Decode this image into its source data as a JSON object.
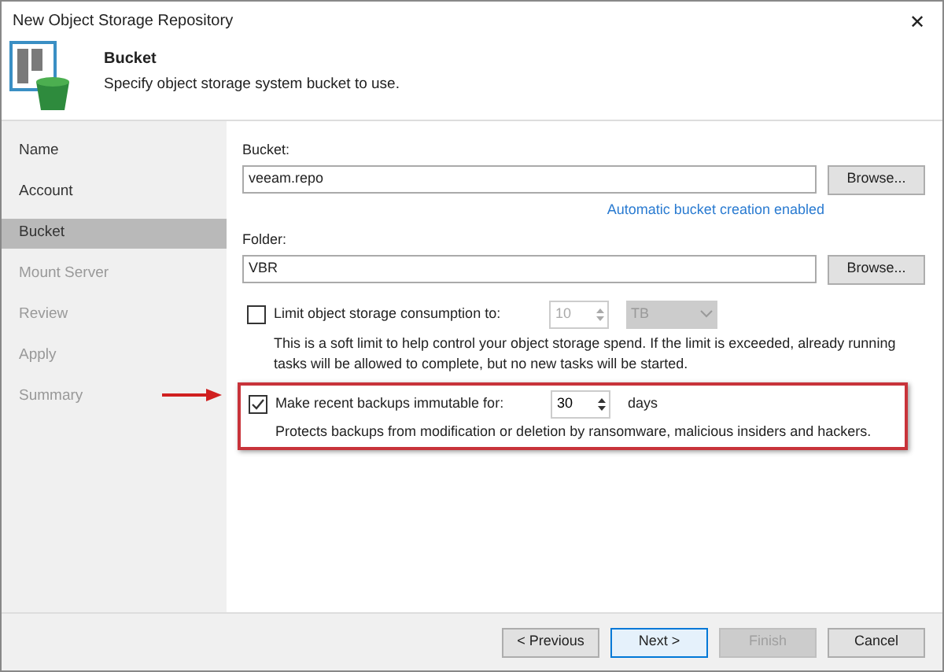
{
  "window": {
    "title": "New Object Storage Repository",
    "close": "✕"
  },
  "header": {
    "title": "Bucket",
    "subtitle": "Specify object storage system bucket to use."
  },
  "sidebar": {
    "items": [
      {
        "label": "Name",
        "selected": false,
        "disabled": false
      },
      {
        "label": "Account",
        "selected": false,
        "disabled": false
      },
      {
        "label": "Bucket",
        "selected": true,
        "disabled": false
      },
      {
        "label": "Mount Server",
        "selected": false,
        "disabled": true
      },
      {
        "label": "Review",
        "selected": false,
        "disabled": true
      },
      {
        "label": "Apply",
        "selected": false,
        "disabled": true
      },
      {
        "label": "Summary",
        "selected": false,
        "disabled": true
      }
    ]
  },
  "bucket": {
    "label": "Bucket:",
    "value": "veeam.repo",
    "browse": "Browse...",
    "link": "Automatic bucket creation enabled"
  },
  "folder": {
    "label": "Folder:",
    "value": "VBR",
    "browse": "Browse..."
  },
  "limit": {
    "label": "Limit object storage consumption to:",
    "checked": false,
    "value": "10",
    "unit": "TB",
    "disabled": true,
    "help": "This is a soft limit to help control your object storage spend. If the limit is exceeded, already running tasks will be allowed to complete, but no new tasks will be started."
  },
  "immutable": {
    "label": "Make recent backups immutable for:",
    "checked": true,
    "value": "30",
    "unit": "days",
    "disabled": false,
    "help": "Protects backups from modification or deletion by ransomware, malicious insiders and hackers.",
    "highlighted": true
  },
  "buttons": [
    {
      "label": "< Previous",
      "disabled": false,
      "default": false
    },
    {
      "label": "Next >",
      "disabled": false,
      "default": true
    },
    {
      "label": "Finish",
      "disabled": true,
      "default": false
    },
    {
      "label": "Cancel",
      "disabled": false,
      "default": false
    }
  ]
}
